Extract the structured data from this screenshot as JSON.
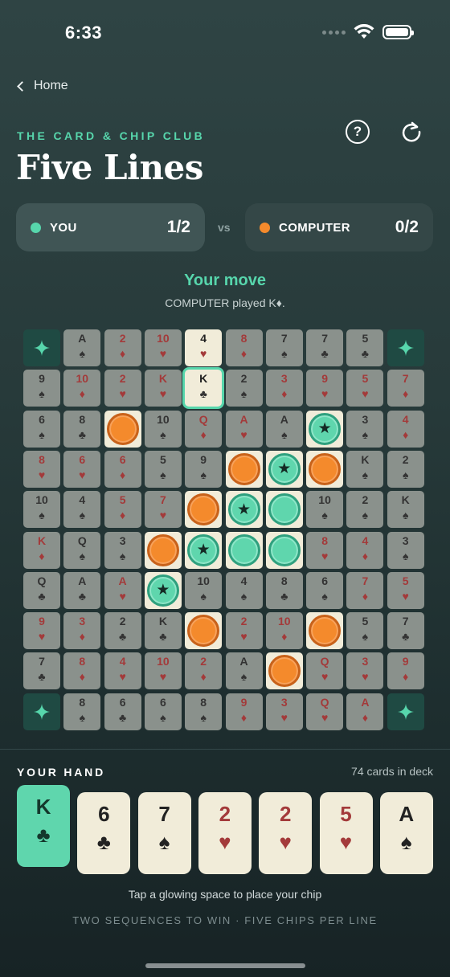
{
  "status": {
    "time": "6:33"
  },
  "nav": {
    "back_label": "Home"
  },
  "header": {
    "subtitle": "THE CARD & CHIP CLUB",
    "title": "Five Lines",
    "help_label": "?"
  },
  "scores": {
    "you": {
      "name": "YOU",
      "score": "1/2",
      "color": "#57d6ac"
    },
    "vs": "vs",
    "computer": {
      "name": "COMPUTER",
      "score": "0/2",
      "color": "#f48a2c"
    }
  },
  "turn": {
    "message": "Your move",
    "last_play": "COMPUTER played K♦."
  },
  "board": {
    "rows": [
      [
        "★",
        "A♠",
        "2♦",
        "10♥",
        "4♥",
        "8♦",
        "7♠",
        "7♣",
        "5♣",
        "★"
      ],
      [
        "9♠",
        "10♦",
        "2♥",
        "K♥",
        "K♣",
        "2♠",
        "3♦",
        "9♥",
        "5♥",
        "7♦"
      ],
      [
        "6♠",
        "8♣",
        "●",
        "10♠",
        "Q♦",
        "A♥",
        "A♠",
        "*",
        "3♠",
        "4♦"
      ],
      [
        "8♥",
        "6♥",
        "6♦",
        "5♠",
        "9♠",
        "●",
        "*",
        "●",
        "K♠",
        "2♠"
      ],
      [
        "10♠",
        "4♠",
        "5♦",
        "7♥",
        "●",
        "*",
        "○",
        "10♠",
        "2♠",
        "K♠"
      ],
      [
        "K♦",
        "Q♠",
        "3♠",
        "●",
        "*",
        "○",
        "○",
        "8♥",
        "4♦",
        "3♠"
      ],
      [
        "Q♣",
        "A♣",
        "A♥",
        "*",
        "10♠",
        "4♠",
        "8♣",
        "6♠",
        "7♦",
        "5♥"
      ],
      [
        "9♥",
        "3♦",
        "2♣",
        "K♣",
        "●",
        "2♥",
        "10♦",
        "●",
        "5♠",
        "7♣"
      ],
      [
        "7♣",
        "8♦",
        "4♥",
        "10♥",
        "2♦",
        "A♠",
        "●",
        "Q♥",
        "3♥",
        "9♦"
      ],
      [
        "★",
        "8♠",
        "6♣",
        "6♠",
        "8♠",
        "9♦",
        "3♥",
        "Q♥",
        "A♦",
        "★"
      ]
    ],
    "legend": {
      "●": "computer chip",
      "○": "your chip",
      "*": "your chip in sequence",
      "★": "free corner"
    },
    "highlighted": [
      "0,4"
    ],
    "last_played": "1,4"
  },
  "hand": {
    "label": "YOUR HAND",
    "deck_count": "74 cards in deck",
    "cards": [
      {
        "rank": "K",
        "suit": "♣",
        "selected": true
      },
      {
        "rank": "6",
        "suit": "♣"
      },
      {
        "rank": "7",
        "suit": "♠"
      },
      {
        "rank": "2",
        "suit": "♥"
      },
      {
        "rank": "2",
        "suit": "♥"
      },
      {
        "rank": "5",
        "suit": "♥"
      },
      {
        "rank": "A",
        "suit": "♠"
      }
    ]
  },
  "footer": {
    "tip": "Tap a glowing space to place your chip",
    "rules": "TWO SEQUENCES TO WIN · FIVE CHIPS PER LINE"
  }
}
